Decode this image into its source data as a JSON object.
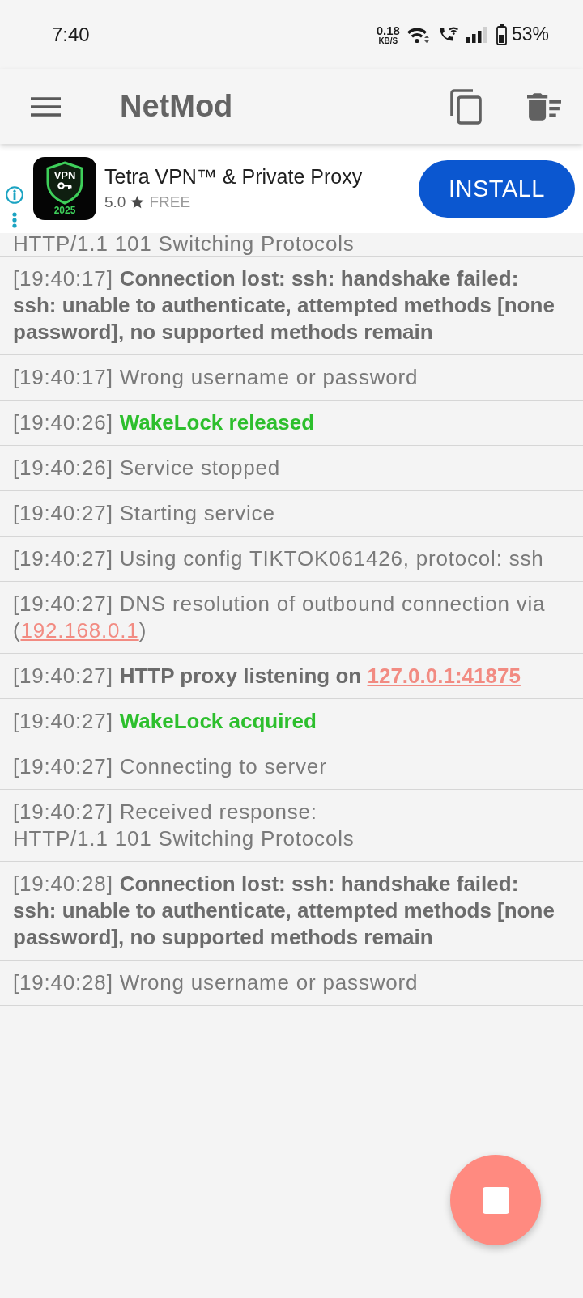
{
  "status_bar": {
    "time": "7:40",
    "net_speed": "0.18",
    "net_unit": "KB/S",
    "battery": "53%"
  },
  "app_bar": {
    "title": "NetMod"
  },
  "ad": {
    "logo_text": "VPN",
    "logo_year": "2025",
    "title": "Tetra VPN™ & Private Proxy",
    "rating": "5.0",
    "price": "FREE",
    "button": "INSTALL"
  },
  "log": {
    "clipped_line": "HTTP/1.1 101 Switching Protocols",
    "entries": [
      {
        "time": "[19:40:17]",
        "kind": "bold",
        "message": "Connection lost: ssh: handshake failed: ssh: unable to authenticate, attempted methods [none password], no supported methods remain"
      },
      {
        "time": "[19:40:17]",
        "kind": "normal",
        "message": "Wrong username or password"
      },
      {
        "time": "[19:40:26]",
        "kind": "success",
        "message": "WakeLock released"
      },
      {
        "time": "[19:40:26]",
        "kind": "normal",
        "message": "Service stopped"
      },
      {
        "time": "[19:40:27]",
        "kind": "normal",
        "message": "Starting service"
      },
      {
        "time": "[19:40:27]",
        "kind": "normal",
        "message": "Using config TIKTOK061426, protocol: ssh"
      },
      {
        "time": "[19:40:27]",
        "kind": "normal",
        "message": "DNS resolution of outbound connection via (",
        "link": "192.168.0.1",
        "after": ")"
      },
      {
        "time": "[19:40:27]",
        "kind": "bold",
        "message": "HTTP proxy listening on ",
        "link": "127.0.0.1:41875"
      },
      {
        "time": "[19:40:27]",
        "kind": "success",
        "message": "WakeLock acquired"
      },
      {
        "time": "[19:40:27]",
        "kind": "normal",
        "message": "Connecting to server"
      },
      {
        "time": "[19:40:27]",
        "kind": "normal",
        "message": "Received response:\nHTTP/1.1 101 Switching Protocols"
      },
      {
        "time": "[19:40:28]",
        "kind": "bold",
        "message": "Connection lost: ssh: handshake failed: ssh: unable to authenticate, attempted methods [none password], no supported methods remain"
      },
      {
        "time": "[19:40:28]",
        "kind": "normal",
        "message": "Wrong username or password"
      }
    ]
  }
}
